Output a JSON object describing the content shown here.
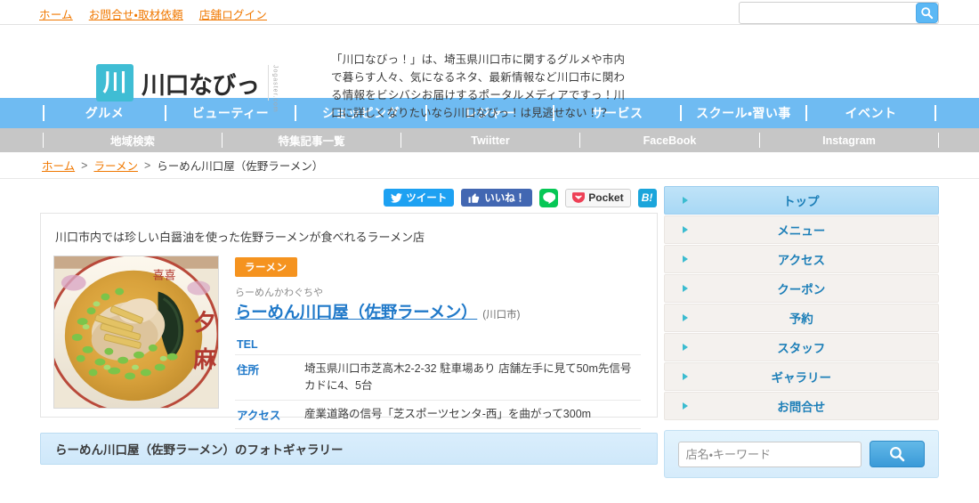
{
  "topbar": {
    "links": [
      {
        "label": "ホーム"
      },
      {
        "label": "お問合せ・取材依頼"
      },
      {
        "label": "店舗ログイン"
      }
    ],
    "search": {
      "value": "",
      "placeholder": ""
    },
    "search_icon": "search-icon"
  },
  "header": {
    "logo_mark": "川",
    "logo_text": "川口なびっ",
    "logo_domain": "Jogaster.com",
    "description": "「川口なびっ！」は、埼玉県川口市に関するグルメや市内で暮らす人々、気になるネタ、最新情報など川口市に関わる情報をビシバシお届けするポータルメディアですっ！川口に詳しくなりたいなら川口なびっ！は見逃せない！？"
  },
  "mainnav": {
    "items": [
      {
        "label": "グルメ"
      },
      {
        "label": "ビューティー"
      },
      {
        "label": "ショッピング"
      },
      {
        "label": "レジャー"
      },
      {
        "label": "サービス"
      },
      {
        "label": "スクール・習い事"
      },
      {
        "label": "イベント"
      }
    ]
  },
  "subnav": {
    "items": [
      {
        "label": "地域検索"
      },
      {
        "label": "特集記事一覧"
      },
      {
        "label": "Twiitter"
      },
      {
        "label": "FaceBook"
      },
      {
        "label": "Instagram"
      }
    ]
  },
  "breadcrumb": {
    "items": [
      {
        "label": "ホーム",
        "link": true
      },
      {
        "label": "ラーメン",
        "link": true
      },
      {
        "label": "らーめん川口屋（佐野ラーメン）",
        "link": false
      }
    ],
    "separator": ">"
  },
  "share": {
    "twitter_label": "ツイート",
    "facebook_label": "いいね！",
    "line_label": "LINE",
    "pocket_label": "Pocket",
    "hatena_label": "B!"
  },
  "shop": {
    "headline": "川口市内では珍しい白醤油を使った佐野ラーメンが食べれるラーメン店",
    "category_badge": "ラーメン",
    "kana": "らーめんかわぐちや",
    "title": "らーめん川口屋（佐野ラーメン）",
    "city": "(川口市)",
    "photo_alt": "ラーメン写真",
    "info_rows": [
      {
        "label": "TEL",
        "value": ""
      },
      {
        "label": "住所",
        "value": "埼玉県川口市芝高木2-2-32 駐車場あり 店舗左手に見て50m先信号カドに4、5台"
      },
      {
        "label": "アクセス",
        "value": "産業道路の信号「芝スポーツセンタ-西」を曲がって300m"
      }
    ]
  },
  "gallery": {
    "heading": "らーめん川口屋（佐野ラーメン）のフォトギャラリー"
  },
  "sidebar": {
    "items": [
      {
        "label": "トップ",
        "active": true
      },
      {
        "label": "メニュー",
        "active": false
      },
      {
        "label": "アクセス",
        "active": false
      },
      {
        "label": "クーポン",
        "active": false
      },
      {
        "label": "予約",
        "active": false
      },
      {
        "label": "スタッフ",
        "active": false
      },
      {
        "label": "ギャラリー",
        "active": false
      },
      {
        "label": "お問合せ",
        "active": false
      }
    ],
    "search": {
      "value": "",
      "placeholder": "店名・キーワード",
      "button_icon": "search-icon"
    }
  },
  "colors": {
    "accent_orange": "#f07800",
    "nav_blue": "#6fbbf2",
    "subnav_gray": "#c6c6c6",
    "link_blue": "#2079c9",
    "badge_orange": "#f5931f",
    "logo_teal": "#3fbdd4"
  }
}
